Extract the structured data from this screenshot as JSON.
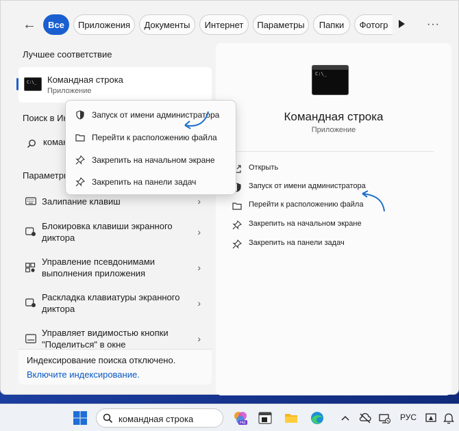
{
  "filters": {
    "back_label": "←",
    "chips": [
      "Все",
      "Приложения",
      "Документы",
      "Интернет",
      "Параметры",
      "Папки",
      "Фотогр"
    ],
    "more_label": "···"
  },
  "left": {
    "best_match_title": "Лучшее соответствие",
    "best_match": {
      "name": "Командная строка",
      "type": "Приложение",
      "icon_text": "C:\\_"
    },
    "web_title": "Поиск в Ин",
    "web_query": "коман",
    "settings_title": "Параметры",
    "settings_items": [
      {
        "label": "Залипание клавиш",
        "icon": "keyboard-icon"
      },
      {
        "label": "Блокировка клавиши экранного диктора",
        "icon": "narrator-icon"
      },
      {
        "label": "Управление псевдонимами выполнения приложения",
        "icon": "app-alias-icon"
      },
      {
        "label": "Раскладка клавиатуры экранного диктора",
        "icon": "narrator-icon"
      },
      {
        "label": "Управляет видимостью кнопки \"Поделиться\" в окне",
        "icon": "window-icon"
      }
    ],
    "index_text": "Индексирование поиска отключено.",
    "index_link": "Включите индексирование."
  },
  "context_menu": {
    "items": [
      {
        "label": "Запуск от имени администратора",
        "icon": "shield-icon"
      },
      {
        "label": "Перейти к расположению файла",
        "icon": "folder-icon"
      },
      {
        "label": "Закрепить на начальном экране",
        "icon": "pin-icon"
      },
      {
        "label": "Закрепить на панели задач",
        "icon": "pin-icon"
      }
    ]
  },
  "right": {
    "title": "Командная строка",
    "subtitle": "Приложение",
    "icon_text": "C:\\_",
    "actions": [
      {
        "label": "Открыть",
        "icon": "open-icon"
      },
      {
        "label": "Запуск от имени администратора",
        "icon": "shield-icon"
      },
      {
        "label": "Перейти к расположению файла",
        "icon": "folder-icon"
      },
      {
        "label": "Закрепить на начальном экране",
        "icon": "pin-icon"
      },
      {
        "label": "Закрепить на панели задач",
        "icon": "pin-icon"
      }
    ]
  },
  "taskbar": {
    "search_value": "командная строка",
    "language": "РУС",
    "accent_color": "#1a5fd0"
  }
}
